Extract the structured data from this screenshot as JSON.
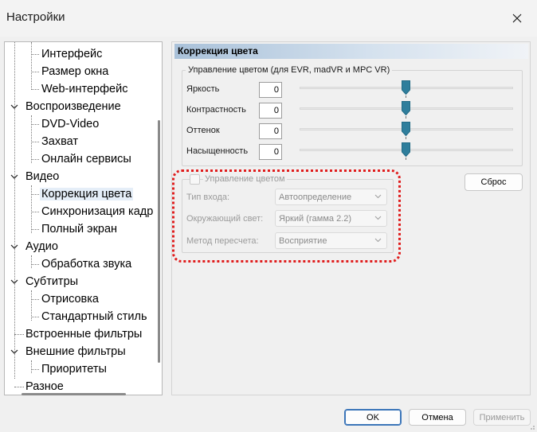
{
  "window": {
    "title": "Настройки",
    "close_icon": "close-icon"
  },
  "tree": {
    "items": [
      {
        "label": "Интерфейс",
        "level": 1
      },
      {
        "label": "Размер окна",
        "level": 1
      },
      {
        "label": "Web-интерфейс",
        "level": 1
      },
      {
        "label": "Воспроизведение",
        "level": 0,
        "expanded": true
      },
      {
        "label": "DVD-Video",
        "level": 1
      },
      {
        "label": "Захват",
        "level": 1
      },
      {
        "label": "Онлайн сервисы",
        "level": 1
      },
      {
        "label": "Видео",
        "level": 0,
        "expanded": true
      },
      {
        "label": "Коррекция цвета",
        "level": 1,
        "selected": true
      },
      {
        "label": "Синхронизация кадр",
        "level": 1
      },
      {
        "label": "Полный экран",
        "level": 1
      },
      {
        "label": "Аудио",
        "level": 0,
        "expanded": true
      },
      {
        "label": "Обработка звука",
        "level": 1
      },
      {
        "label": "Субтитры",
        "level": 0,
        "expanded": true
      },
      {
        "label": "Отрисовка",
        "level": 1
      },
      {
        "label": "Стандартный стиль",
        "level": 1
      },
      {
        "label": "Встроенные фильтры",
        "level": 0
      },
      {
        "label": "Внешние фильтры",
        "level": 0,
        "expanded": true
      },
      {
        "label": "Приоритеты",
        "level": 1
      },
      {
        "label": "Разное",
        "level": 0
      }
    ]
  },
  "panel": {
    "header": "Коррекция цвета",
    "color_group": {
      "legend": "Управление цветом (для EVR, madVR и MPC VR)",
      "sliders": [
        {
          "label": "Яркость",
          "value": "0",
          "level": 0.5
        },
        {
          "label": "Контрастность",
          "value": "0",
          "level": 0.5
        },
        {
          "label": "Оттенок",
          "value": "0",
          "level": 0.5
        },
        {
          "label": "Насыщенность",
          "value": "0",
          "level": 0.5
        }
      ]
    },
    "reset_button": "Сброс",
    "cms_group": {
      "checkbox_label": "Управление цветом",
      "checked": false,
      "rows": [
        {
          "label": "Тип входа:",
          "value": "Автоопределение"
        },
        {
          "label": "Окружающий свет:",
          "value": "Яркий (гамма 2.2)"
        },
        {
          "label": "Метод пересчета:",
          "value": "Восприятие"
        }
      ]
    },
    "highlight_color": "#e01d1d",
    "thumb_color": "#2f7e9c"
  },
  "footer": {
    "ok": "OK",
    "cancel": "Отмена",
    "apply": "Применить"
  }
}
